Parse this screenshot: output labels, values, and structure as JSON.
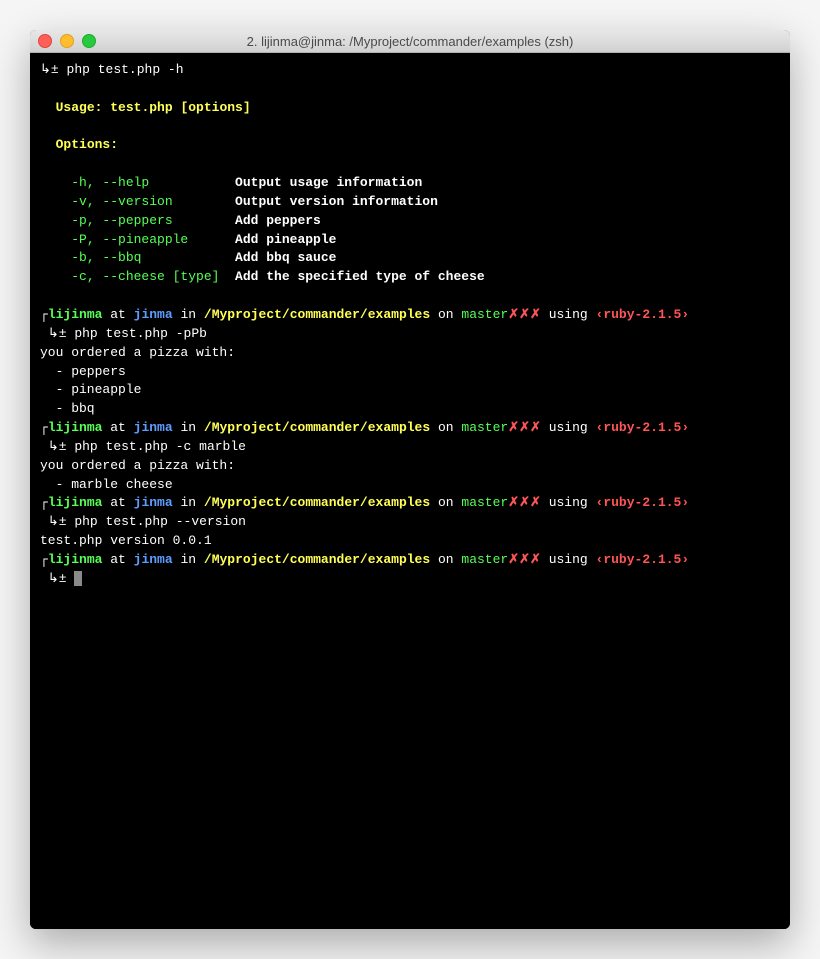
{
  "window": {
    "title": "2. lijinma@jinma: /Myproject/commander/examples (zsh)"
  },
  "session": {
    "prompt_symbol": "↳±",
    "user": "lijinma",
    "at": "at",
    "host": "jinma",
    "in": "in",
    "path": "/Myproject/commander/examples",
    "on": "on",
    "branch": "master",
    "dirty": "✗✗✗",
    "using": "using",
    "ruby": "‹ruby-2.1.5›",
    "corner": "┌",
    "corner2": "└"
  },
  "cmd1": {
    "line": "php test.php -h"
  },
  "help": {
    "usage_label": "Usage:",
    "usage_value": "test.php [options]",
    "options_label": "Options:",
    "rows": [
      {
        "flag": "-h, --help",
        "desc": "Output usage information"
      },
      {
        "flag": "-v, --version",
        "desc": "Output version information"
      },
      {
        "flag": "-p, --peppers",
        "desc": "Add peppers"
      },
      {
        "flag": "-P, --pineapple",
        "desc": "Add pineapple"
      },
      {
        "flag": "-b, --bbq",
        "desc": "Add bbq sauce"
      },
      {
        "flag": "-c, --cheese [type]",
        "desc": "Add the specified type of cheese"
      }
    ]
  },
  "cmd2": {
    "line": "php test.php -pPb",
    "out_header": "you ordered a pizza with:",
    "out_items": [
      "  - peppers",
      "  - pineapple",
      "  - bbq"
    ]
  },
  "cmd3": {
    "line": "php test.php -c marble",
    "out_header": "you ordered a pizza with:",
    "out_items": [
      "  - marble cheese"
    ]
  },
  "cmd4": {
    "line": "php test.php --version",
    "out": "test.php version 0.0.1"
  }
}
